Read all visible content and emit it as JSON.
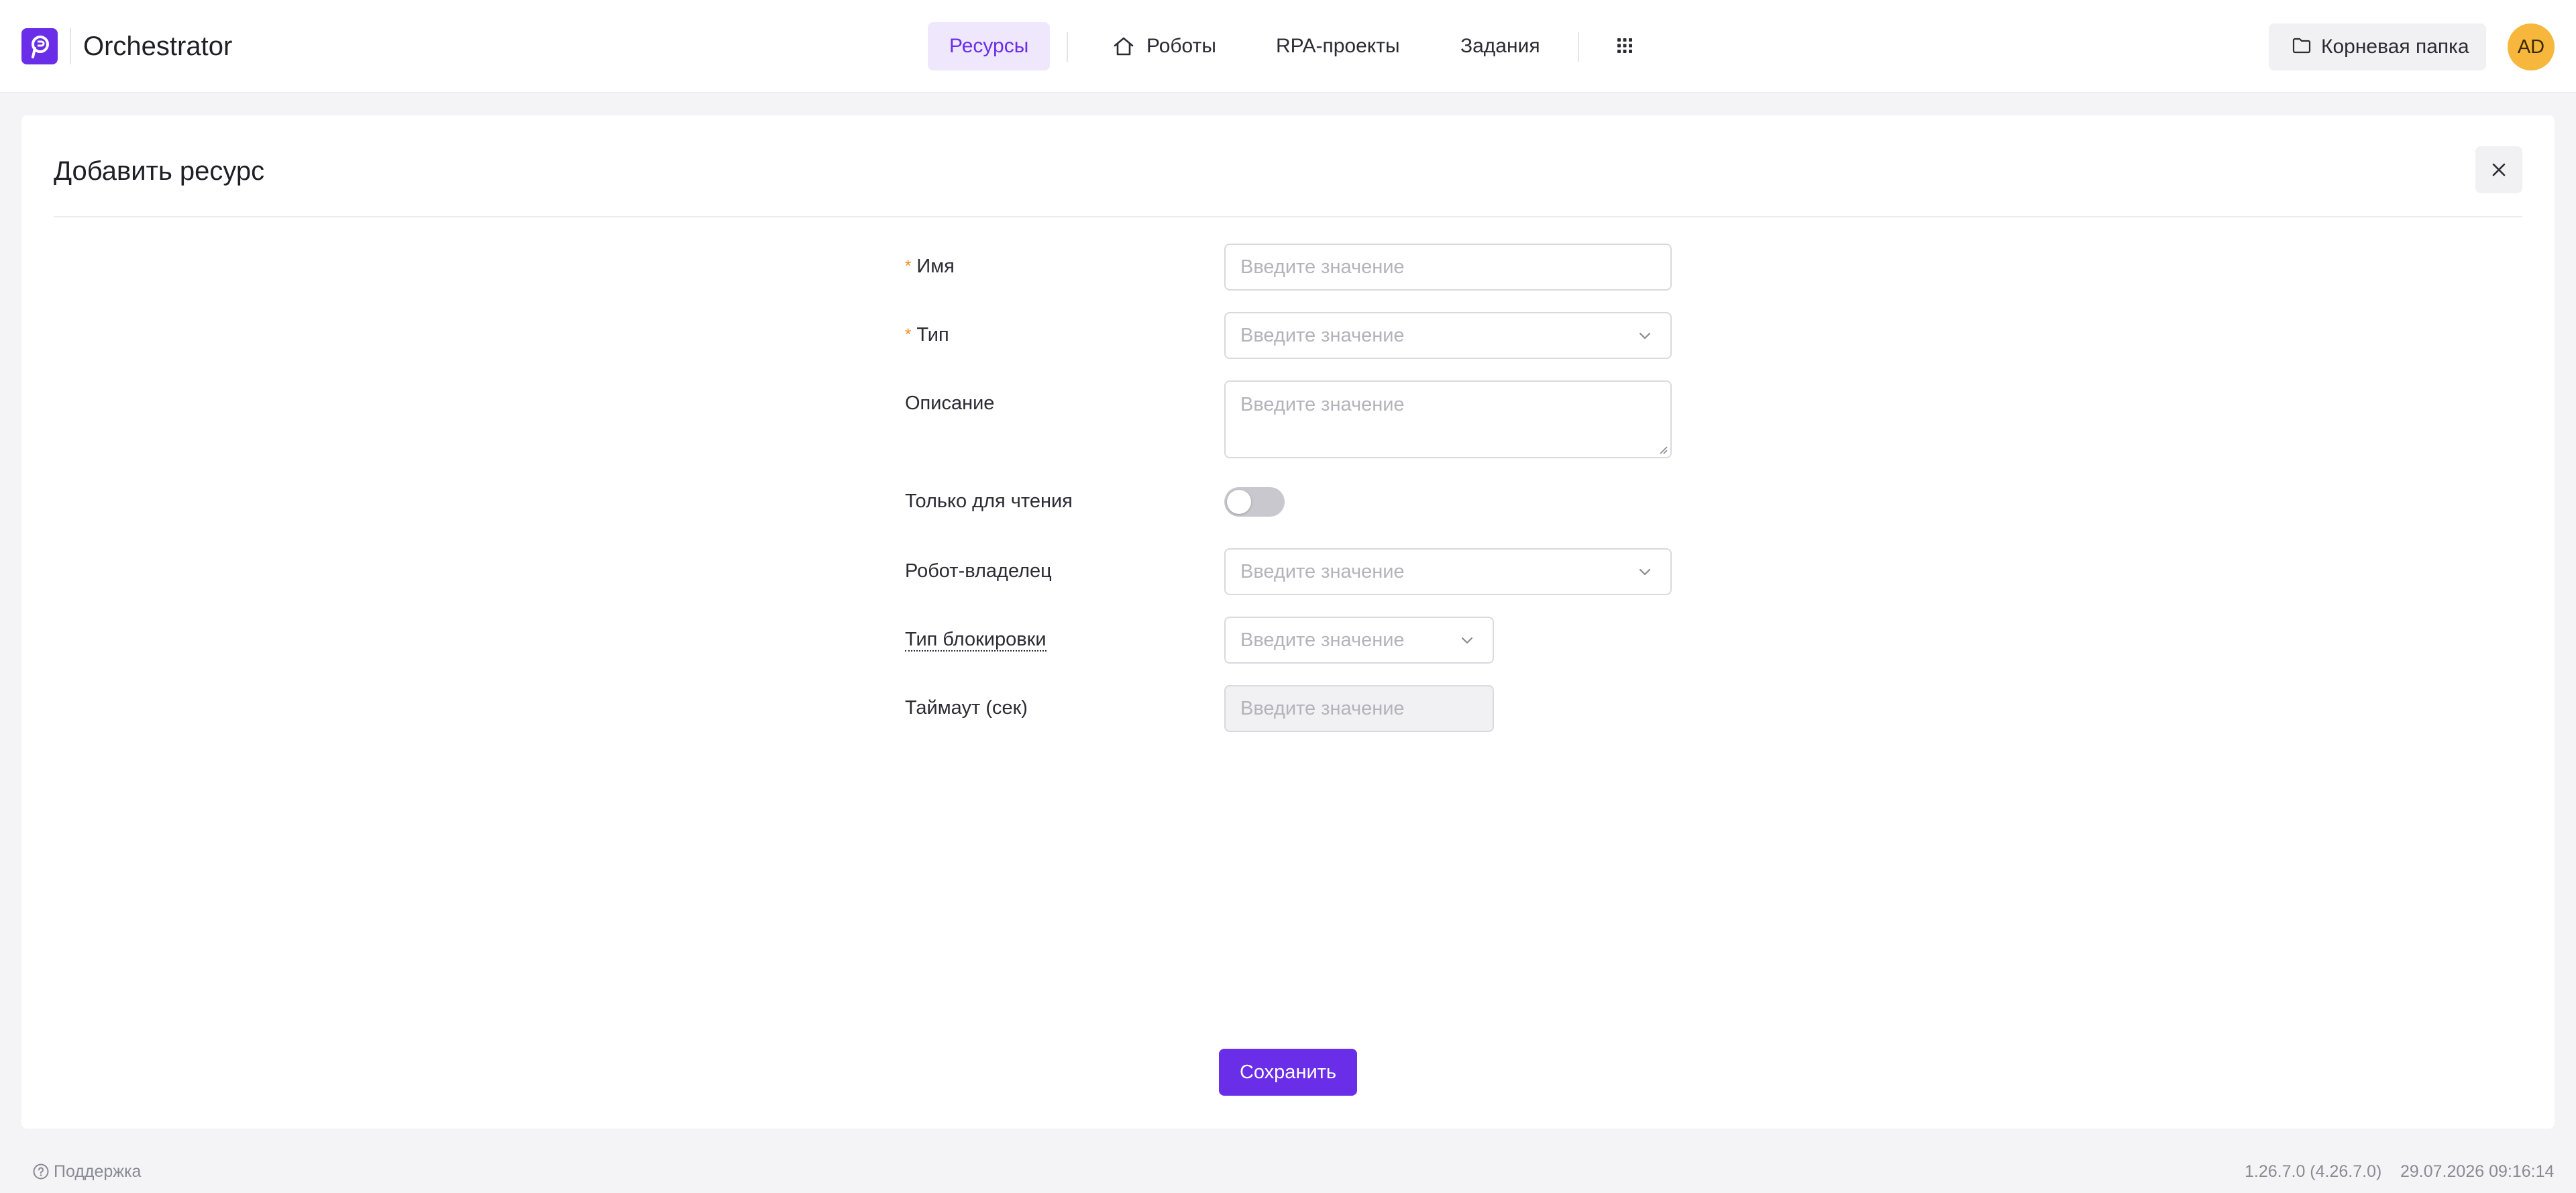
{
  "app": {
    "title": "Orchestrator",
    "brand_color": "#6a2ee8"
  },
  "nav": {
    "items": [
      {
        "label": "Ресурсы",
        "active": true
      },
      {
        "label": "Роботы",
        "icon": "home-icon",
        "active": false
      },
      {
        "label": "RPA-проекты",
        "active": false
      },
      {
        "label": "Задания",
        "active": false
      }
    ],
    "apps_icon": "grid-icon"
  },
  "folder": {
    "label": "Корневая папка",
    "icon": "folder-icon"
  },
  "user": {
    "initials": "AD",
    "avatar_color": "#f6b73c"
  },
  "dialog": {
    "title": "Добавить ресурс",
    "close_icon": "close-icon",
    "fields": {
      "name": {
        "label": "Имя",
        "required": true,
        "placeholder": "Введите значение",
        "value": ""
      },
      "type": {
        "label": "Тип",
        "required": true,
        "placeholder": "Введите значение",
        "value": ""
      },
      "description": {
        "label": "Описание",
        "placeholder": "Введите значение",
        "value": ""
      },
      "readonly": {
        "label": "Только для чтения",
        "checked": false
      },
      "owner_robot": {
        "label": "Робот-владелец",
        "placeholder": "Введите значение",
        "value": ""
      },
      "lock_type": {
        "label": "Тип блокировки",
        "placeholder": "Введите значение",
        "value": ""
      },
      "timeout": {
        "label": "Таймаут (сек)",
        "placeholder": "Введите значение",
        "value": "",
        "disabled": true
      }
    },
    "required_marker": "*",
    "save_label": "Сохранить"
  },
  "footer": {
    "support_label": "Поддержка",
    "version": "1.26.7.0 (4.26.7.0)",
    "datetime": "29.07.2026 09:16:14"
  }
}
